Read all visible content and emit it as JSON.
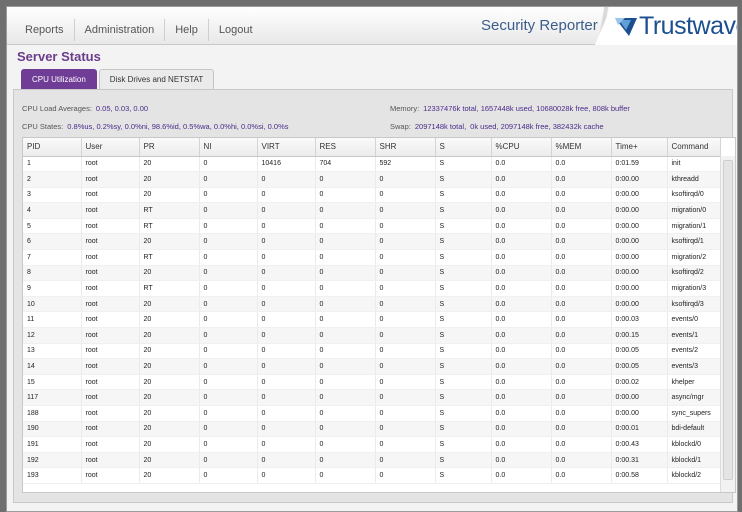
{
  "nav": {
    "items": [
      "Reports",
      "Administration",
      "Help",
      "Logout"
    ]
  },
  "header": {
    "product": "Security Reporter",
    "brand": "Trustwave",
    "brand_mark": "®"
  },
  "page_title": "Server Status",
  "tabs": [
    "CPU Utilization",
    "Disk Drives and NETSTAT"
  ],
  "stats": {
    "load_label": "CPU Load Averages:",
    "load_value": "0.05, 0.03, 0.00",
    "states_label": "CPU States:",
    "states_value": "0.8%us, 0.2%sy, 0.0%ni, 98.6%id, 0.5%wa, 0.0%hi, 0.0%si, 0.0%s",
    "memory_label": "Memory:",
    "memory_value": "12337476k total, 1657448k used, 10680028k free, 808k buffer",
    "swap_label": "Swap:",
    "swap_total": "2097148k total,",
    "swap_used": "0k used, 2097148k free, 382432k cache"
  },
  "table": {
    "headers": [
      "PID",
      "User",
      "PR",
      "NI",
      "VIRT",
      "RES",
      "SHR",
      "S",
      "%CPU",
      "%MEM",
      "Time+",
      "Command"
    ],
    "rows": [
      [
        "1",
        "root",
        "20",
        "0",
        "10416",
        "704",
        "592",
        "S",
        "0.0",
        "0.0",
        "0:01.59",
        "init"
      ],
      [
        "2",
        "root",
        "20",
        "0",
        "0",
        "0",
        "0",
        "S",
        "0.0",
        "0.0",
        "0:00.00",
        "kthreadd"
      ],
      [
        "3",
        "root",
        "20",
        "0",
        "0",
        "0",
        "0",
        "S",
        "0.0",
        "0.0",
        "0:00.00",
        "ksoftirqd/0"
      ],
      [
        "4",
        "root",
        "RT",
        "0",
        "0",
        "0",
        "0",
        "S",
        "0.0",
        "0.0",
        "0:00.00",
        "migration/0"
      ],
      [
        "5",
        "root",
        "RT",
        "0",
        "0",
        "0",
        "0",
        "S",
        "0.0",
        "0.0",
        "0:00.00",
        "migration/1"
      ],
      [
        "6",
        "root",
        "20",
        "0",
        "0",
        "0",
        "0",
        "S",
        "0.0",
        "0.0",
        "0:00.00",
        "ksoftirqd/1"
      ],
      [
        "7",
        "root",
        "RT",
        "0",
        "0",
        "0",
        "0",
        "S",
        "0.0",
        "0.0",
        "0:00.00",
        "migration/2"
      ],
      [
        "8",
        "root",
        "20",
        "0",
        "0",
        "0",
        "0",
        "S",
        "0.0",
        "0.0",
        "0:00.00",
        "ksoftirqd/2"
      ],
      [
        "9",
        "root",
        "RT",
        "0",
        "0",
        "0",
        "0",
        "S",
        "0.0",
        "0.0",
        "0:00.00",
        "migration/3"
      ],
      [
        "10",
        "root",
        "20",
        "0",
        "0",
        "0",
        "0",
        "S",
        "0.0",
        "0.0",
        "0:00.00",
        "ksoftirqd/3"
      ],
      [
        "11",
        "root",
        "20",
        "0",
        "0",
        "0",
        "0",
        "S",
        "0.0",
        "0.0",
        "0:00.03",
        "events/0"
      ],
      [
        "12",
        "root",
        "20",
        "0",
        "0",
        "0",
        "0",
        "S",
        "0.0",
        "0.0",
        "0:00.15",
        "events/1"
      ],
      [
        "13",
        "root",
        "20",
        "0",
        "0",
        "0",
        "0",
        "S",
        "0.0",
        "0.0",
        "0:00.05",
        "events/2"
      ],
      [
        "14",
        "root",
        "20",
        "0",
        "0",
        "0",
        "0",
        "S",
        "0.0",
        "0.0",
        "0:00.05",
        "events/3"
      ],
      [
        "15",
        "root",
        "20",
        "0",
        "0",
        "0",
        "0",
        "S",
        "0.0",
        "0.0",
        "0:00.02",
        "khelper"
      ],
      [
        "117",
        "root",
        "20",
        "0",
        "0",
        "0",
        "0",
        "S",
        "0.0",
        "0.0",
        "0:00.00",
        "async/mgr"
      ],
      [
        "188",
        "root",
        "20",
        "0",
        "0",
        "0",
        "0",
        "S",
        "0.0",
        "0.0",
        "0:00.00",
        "sync_supers"
      ],
      [
        "190",
        "root",
        "20",
        "0",
        "0",
        "0",
        "0",
        "S",
        "0.0",
        "0.0",
        "0:00.01",
        "bdi-default"
      ],
      [
        "191",
        "root",
        "20",
        "0",
        "0",
        "0",
        "0",
        "S",
        "0.0",
        "0.0",
        "0:00.43",
        "kblockd/0"
      ],
      [
        "192",
        "root",
        "20",
        "0",
        "0",
        "0",
        "0",
        "S",
        "0.0",
        "0.0",
        "0:00.31",
        "kblockd/1"
      ],
      [
        "193",
        "root",
        "20",
        "0",
        "0",
        "0",
        "0",
        "S",
        "0.0",
        "0.0",
        "0:00.58",
        "kblockd/2"
      ]
    ]
  },
  "colors": {
    "accent": "#6f3c96",
    "brand": "#1b4f8f",
    "stat_value": "#4a2b8a"
  }
}
